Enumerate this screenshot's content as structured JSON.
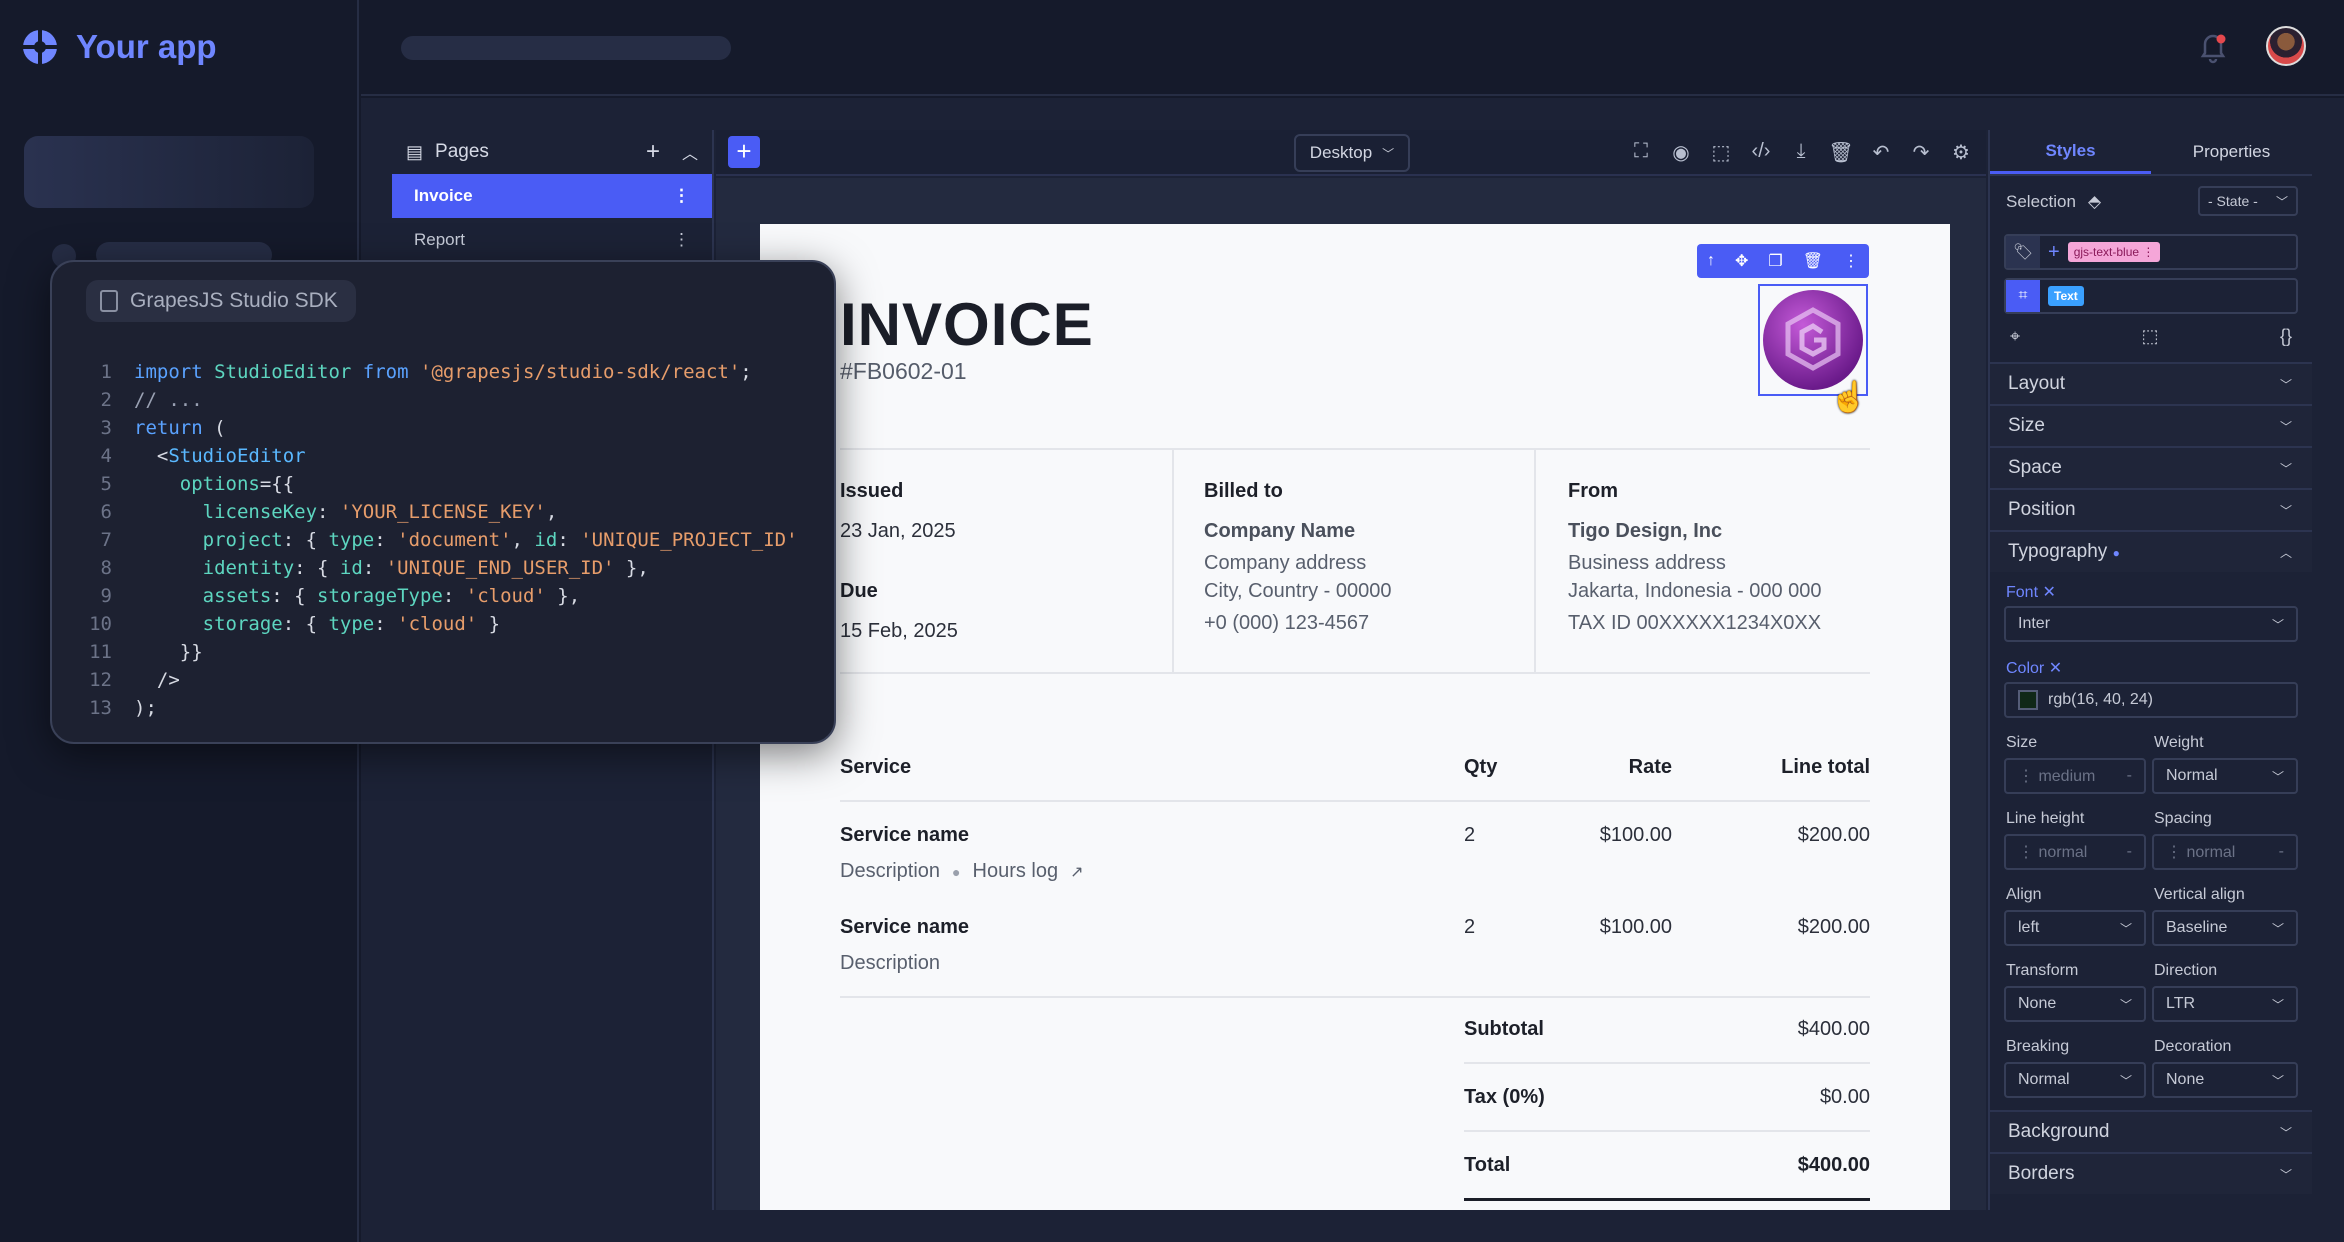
{
  "app": {
    "name": "Your app"
  },
  "pages_panel": {
    "title": "Pages",
    "items": [
      {
        "label": "Invoice",
        "active": true
      },
      {
        "label": "Report",
        "active": false
      }
    ]
  },
  "toolbar": {
    "device": "Desktop"
  },
  "code_card": {
    "title": "GrapesJS Studio SDK",
    "lines": [
      [
        {
          "t": "k",
          "v": "import "
        },
        {
          "t": "c",
          "v": "StudioEditor"
        },
        {
          "t": "k",
          "v": " from "
        },
        {
          "t": "s",
          "v": "'@grapesjs/studio-sdk/react'"
        },
        {
          "t": "p",
          "v": ";"
        }
      ],
      [
        {
          "t": "cm",
          "v": "// ..."
        }
      ],
      [
        {
          "t": "k",
          "v": "return "
        },
        {
          "t": "p",
          "v": "("
        }
      ],
      [
        {
          "t": "p",
          "v": "  <"
        },
        {
          "t": "t",
          "v": "StudioEditor"
        }
      ],
      [
        {
          "t": "c",
          "v": "    options"
        },
        {
          "t": "p",
          "v": "={{"
        }
      ],
      [
        {
          "t": "c",
          "v": "      licenseKey"
        },
        {
          "t": "p",
          "v": ": "
        },
        {
          "t": "s",
          "v": "'YOUR_LICENSE_KEY'"
        },
        {
          "t": "p",
          "v": ","
        }
      ],
      [
        {
          "t": "c",
          "v": "      project"
        },
        {
          "t": "p",
          "v": ": { "
        },
        {
          "t": "c",
          "v": "type"
        },
        {
          "t": "p",
          "v": ": "
        },
        {
          "t": "s",
          "v": "'document'"
        },
        {
          "t": "p",
          "v": ", "
        },
        {
          "t": "c",
          "v": "id"
        },
        {
          "t": "p",
          "v": ": "
        },
        {
          "t": "s",
          "v": "'UNIQUE_PROJECT_ID'"
        }
      ],
      [
        {
          "t": "c",
          "v": "      identity"
        },
        {
          "t": "p",
          "v": ": { "
        },
        {
          "t": "c",
          "v": "id"
        },
        {
          "t": "p",
          "v": ": "
        },
        {
          "t": "s",
          "v": "'UNIQUE_END_USER_ID'"
        },
        {
          "t": "p",
          "v": " },"
        }
      ],
      [
        {
          "t": "c",
          "v": "      assets"
        },
        {
          "t": "p",
          "v": ": { "
        },
        {
          "t": "c",
          "v": "storageType"
        },
        {
          "t": "p",
          "v": ": "
        },
        {
          "t": "s",
          "v": "'cloud'"
        },
        {
          "t": "p",
          "v": " },"
        }
      ],
      [
        {
          "t": "c",
          "v": "      storage"
        },
        {
          "t": "p",
          "v": ": { "
        },
        {
          "t": "c",
          "v": "type"
        },
        {
          "t": "p",
          "v": ": "
        },
        {
          "t": "s",
          "v": "'cloud'"
        },
        {
          "t": "p",
          "v": " }"
        }
      ],
      [
        {
          "t": "p",
          "v": "    }}"
        }
      ],
      [
        {
          "t": "p",
          "v": "  />"
        }
      ],
      [
        {
          "t": "p",
          "v": ");"
        }
      ]
    ]
  },
  "invoice": {
    "title": "INVOICE",
    "number": "#FB0602-01",
    "issued_label": "Issued",
    "issued": "23 Jan, 2025",
    "due_label": "Due",
    "due": "15 Feb, 2025",
    "billed_label": "Billed to",
    "billed_name": "Company Name",
    "billed_addr1": "Company address",
    "billed_addr2": "City, Country - 00000",
    "billed_phone": "+0 (000) 123-4567",
    "from_label": "From",
    "from_name": "Tigo Design, Inc",
    "from_addr1": "Business address",
    "from_addr2": "Jakarta, Indonesia - 000 000",
    "from_tax": "TAX ID 00XXXXX1234X0XX",
    "col_service": "Service",
    "col_qty": "Qty",
    "col_rate": "Rate",
    "col_total": "Line total",
    "rows": [
      {
        "name": "Service name",
        "desc": "Description",
        "extra": "Hours log",
        "qty": "2",
        "rate": "$100.00",
        "total": "$200.00"
      },
      {
        "name": "Service name",
        "desc": "Description",
        "extra": "",
        "qty": "2",
        "rate": "$100.00",
        "total": "$200.00"
      }
    ],
    "subtotal_label": "Subtotal",
    "subtotal": "$400.00",
    "tax_label": "Tax (0%)",
    "tax": "$0.00",
    "total_label": "Total",
    "total": "$400.00"
  },
  "styles_panel": {
    "tabs": [
      "Styles",
      "Properties"
    ],
    "selection_label": "Selection",
    "state": "- State -",
    "class_tag": "gjs-text-blue",
    "type_tag": "Text",
    "sections_top": [
      "Layout",
      "Size",
      "Space",
      "Position",
      "Typography"
    ],
    "font_label": "Font",
    "font_value": "Inter",
    "color_label": "Color",
    "color_value": "rgb(16, 40, 24)",
    "color_swatch": "#102818",
    "size_label": "Size",
    "size_value": "medium",
    "weight_label": "Weight",
    "weight_value": "Normal",
    "lineheight_label": "Line height",
    "lineheight_value": "normal",
    "spacing_label": "Spacing",
    "spacing_value": "normal",
    "align_label": "Align",
    "align_value": "left",
    "valign_label": "Vertical align",
    "valign_value": "Baseline",
    "transform_label": "Transform",
    "transform_value": "None",
    "direction_label": "Direction",
    "direction_value": "LTR",
    "breaking_label": "Breaking",
    "breaking_value": "Normal",
    "decoration_label": "Decoration",
    "decoration_value": "None",
    "sections_bottom": [
      "Background",
      "Borders"
    ]
  },
  "colors": {
    "accent": "#4a5cf5",
    "bg": "#151a2b",
    "panel": "#1c2236"
  }
}
